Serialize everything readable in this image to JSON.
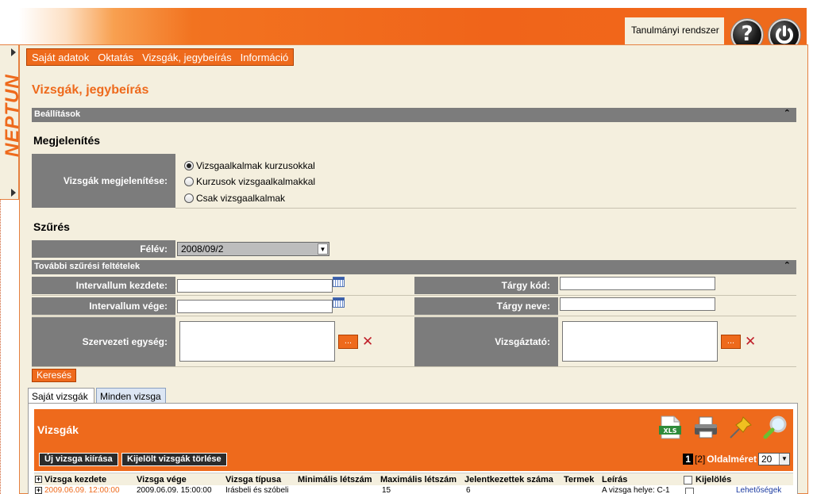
{
  "header": {
    "system_name": "Tanulmányi rendszer",
    "help_icon": "question-icon",
    "logout_icon": "power-icon"
  },
  "side_tab": {
    "logo_text": "NEPTUN"
  },
  "menu": {
    "items": [
      "Saját adatok",
      "Oktatás",
      "Vizsgák, jegybeírás",
      "Információ"
    ]
  },
  "page": {
    "title": "Vizsgák, jegybeírás"
  },
  "settings": {
    "bar_title": "Beállítások",
    "display_heading": "Megjelenítés",
    "display_label": "Vizsgák megjelenítése:",
    "options": [
      {
        "label": "Vizsgaalkalmak kurzusokkal",
        "selected": true
      },
      {
        "label": "Kurzusok vizsgaalkalmakkal",
        "selected": false
      },
      {
        "label": "Csak vizsgaalkalmak",
        "selected": false
      }
    ]
  },
  "filter": {
    "heading": "Szűrés",
    "semester_label": "Félév:",
    "semester_value": "2008/09/2",
    "more_bar_title": "További szűrési feltételek",
    "interval_start_label": "Intervallum kezdete:",
    "interval_end_label": "Intervallum vége:",
    "subject_code_label": "Tárgy kód:",
    "subject_name_label": "Tárgy neve:",
    "org_unit_label": "Szervezeti egység:",
    "examiner_label": "Vizsgáztató:",
    "browse_label": "...",
    "clear_symbol": "✕",
    "search_button": "Keresés"
  },
  "tabs": [
    "Saját vizsgák",
    "Minden vizsga"
  ],
  "exams": {
    "panel_title": "Vizsgák",
    "new_button": "Új vizsga kiírása",
    "delete_button": "Kijelölt vizsgák törlése",
    "icons": [
      "xls-export-icon",
      "print-icon",
      "pin-icon",
      "search-icon"
    ],
    "pager": {
      "current_page": "1",
      "other_page": "[2]",
      "page_size_label": "Oldalméret",
      "page_size_value": "20"
    },
    "columns": [
      "Vizsga kezdete",
      "Vizsga vége",
      "Vizsga típusa",
      "Minimális létszám",
      "Maximális létszám",
      "Jelentkezettek száma",
      "Termek",
      "Leírás",
      "Kijelölés"
    ],
    "rows": [
      {
        "start": "2009.06.09. 12:00:00",
        "end": "2009.06.09. 15:00:00",
        "type": "Írásbeli és szóbeli",
        "max": "15",
        "registered": "6",
        "description": "A vizsga helye: C-1",
        "action": "Lehetőségek"
      }
    ]
  }
}
